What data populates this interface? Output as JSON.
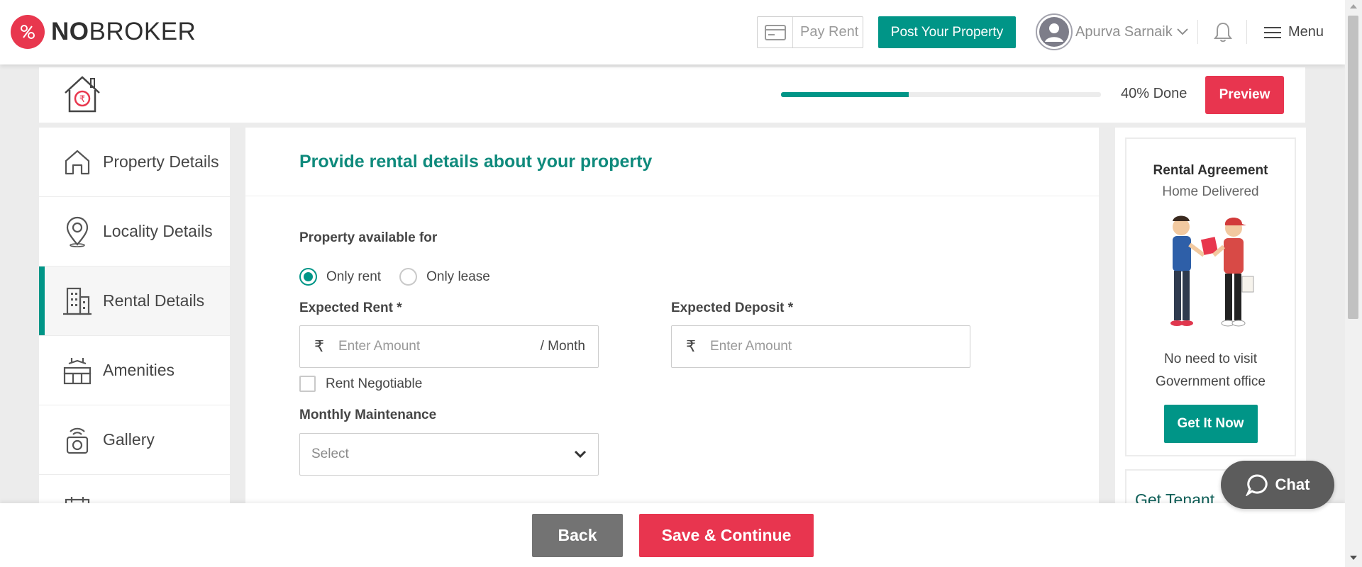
{
  "brand": {
    "logo_bold": "NO",
    "logo_rest": "BROKER",
    "accent": "#009587",
    "red": "#e8354f"
  },
  "topnav": {
    "pay_rent": "Pay Rent",
    "post_property": "Post Your Property",
    "user_name": "Apurva Sarnaik",
    "menu_label": "Menu"
  },
  "progress": {
    "done_label": "40% Done",
    "fraction": 0.4,
    "preview_label": "Preview"
  },
  "sidebar": {
    "items": [
      {
        "label": "Property Details",
        "icon": "home-icon"
      },
      {
        "label": "Locality Details",
        "icon": "location-pin-icon"
      },
      {
        "label": "Rental Details",
        "icon": "building-icon",
        "active": true
      },
      {
        "label": "Amenities",
        "icon": "amenities-icon"
      },
      {
        "label": "Gallery",
        "icon": "camera-icon"
      },
      {
        "label": "",
        "icon": "calendar-icon"
      }
    ]
  },
  "form": {
    "title": "Provide rental details about your property",
    "available_for_label": "Property available for",
    "options": [
      "Only rent",
      "Only lease"
    ],
    "selected_option": "Only rent",
    "expected_rent_label": "Expected Rent *",
    "expected_rent_placeholder": "Enter Amount",
    "expected_rent_suffix": "/ Month",
    "currency_symbol": "₹",
    "expected_deposit_label": "Expected Deposit *",
    "expected_deposit_placeholder": "Enter Amount",
    "rent_negotiable_label": "Rent Negotiable",
    "maintenance_label": "Monthly Maintenance",
    "maintenance_value": "Select"
  },
  "promo": {
    "title": "Rental Agreement",
    "subtitle": "Home Delivered",
    "line1": "No need to visit",
    "line2": "Government office",
    "cta": "Get It Now",
    "next_title": "Get Tenant"
  },
  "chat": {
    "label": "Chat"
  },
  "footer": {
    "back": "Back",
    "save_continue": "Save & Continue"
  }
}
